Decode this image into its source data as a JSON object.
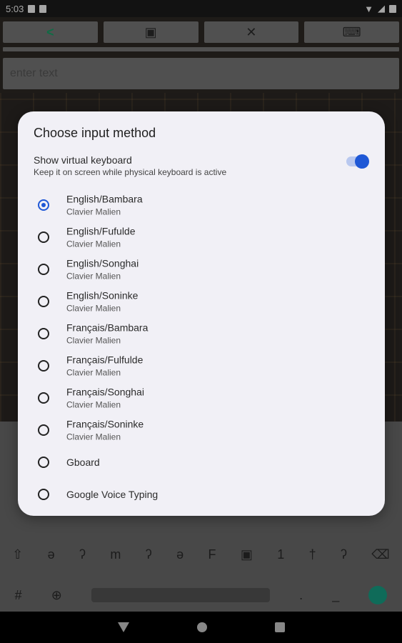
{
  "status": {
    "time": "5:03"
  },
  "toolbar": {
    "buttons": [
      {
        "icon": "share-icon"
      },
      {
        "icon": "save-icon"
      },
      {
        "icon": "close-icon"
      },
      {
        "icon": "keyboard-icon"
      }
    ]
  },
  "editor": {
    "placeholder": "enter text"
  },
  "dialog": {
    "title": "Choose input method",
    "virtual_keyboard": {
      "title": "Show virtual keyboard",
      "subtitle": "Keep it on screen while physical keyboard is active",
      "enabled": true
    },
    "options": [
      {
        "title": "English/Bambara",
        "subtitle": "Clavier Malien",
        "selected": true
      },
      {
        "title": "English/Fufulde",
        "subtitle": "Clavier Malien",
        "selected": false
      },
      {
        "title": "English/Songhai",
        "subtitle": "Clavier Malien",
        "selected": false
      },
      {
        "title": "English/Soninke",
        "subtitle": "Clavier Malien",
        "selected": false
      },
      {
        "title": "Français/Bambara",
        "subtitle": "Clavier Malien",
        "selected": false
      },
      {
        "title": "Français/Fulfulde",
        "subtitle": "Clavier Malien",
        "selected": false
      },
      {
        "title": "Français/Songhai",
        "subtitle": "Clavier Malien",
        "selected": false
      },
      {
        "title": "Français/Soninke",
        "subtitle": "Clavier Malien",
        "selected": false
      },
      {
        "title": "Gboard",
        "subtitle": "",
        "selected": false
      },
      {
        "title": "Google Voice Typing",
        "subtitle": "",
        "selected": false
      }
    ]
  },
  "colors": {
    "accent": "#1f58d6",
    "enter_key": "#17a589"
  }
}
